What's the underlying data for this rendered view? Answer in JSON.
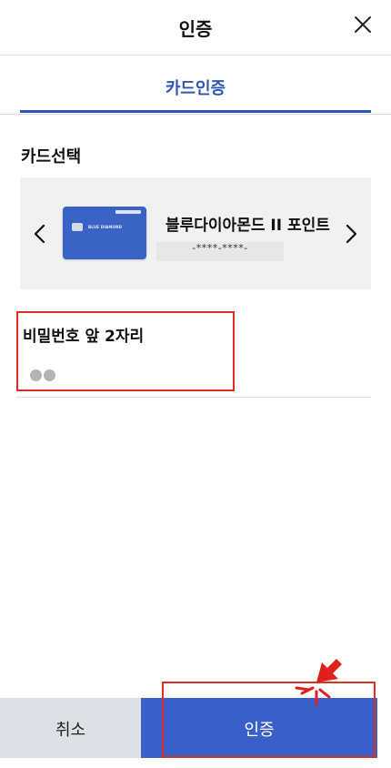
{
  "header": {
    "title": "인증"
  },
  "tabs": [
    {
      "label": "카드인증",
      "active": true
    }
  ],
  "card_section": {
    "label": "카드선택",
    "card": {
      "name": "블루다이아몬드 II 포인트",
      "masked_number": "-****-****-",
      "brand_text": "BLUE DIAMOND"
    }
  },
  "password": {
    "label": "비밀번호 앞 2자리",
    "filled_count": 2
  },
  "footer": {
    "cancel_label": "취소",
    "confirm_label": "인증"
  },
  "colors": {
    "accent": "#3b5fc9",
    "highlight": "#d93025",
    "cancel_bg": "#dde0e4"
  }
}
